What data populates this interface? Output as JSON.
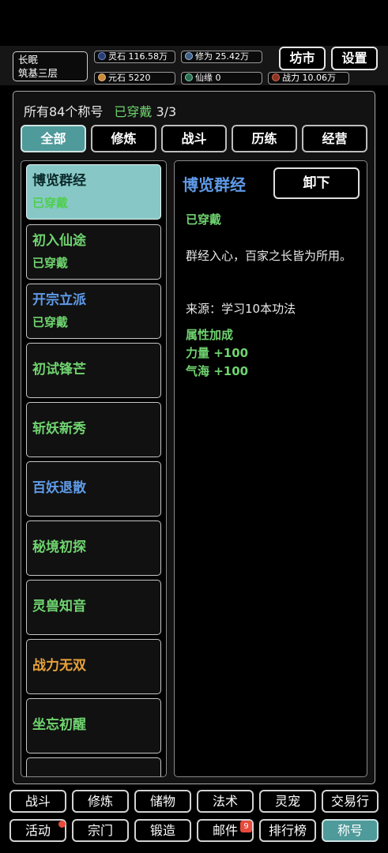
{
  "profile": {
    "name": "长眠",
    "realm": "筑基三层"
  },
  "stats": {
    "lingshi": {
      "label": "灵石",
      "value": "116.58万",
      "icon": "spirit-stone-icon"
    },
    "xiuwei": {
      "label": "修为",
      "value": "25.42万",
      "icon": "cultivation-icon"
    },
    "yuanshi": {
      "label": "元石",
      "value": "5220",
      "icon": "yuan-stone-icon"
    },
    "xianyuan": {
      "label": "仙缘",
      "value": "0",
      "icon": "immortal-fate-icon"
    },
    "zhanli": {
      "label": "战力",
      "value": "10.06万",
      "icon": "combat-power-icon"
    }
  },
  "top_buttons": {
    "market": "坊市",
    "settings": "设置"
  },
  "summary": {
    "total": "所有84个称号",
    "equipped_label": "已穿戴",
    "equipped_count": "3/3"
  },
  "tabs": [
    "全部",
    "修炼",
    "战斗",
    "历练",
    "经营"
  ],
  "active_tab": 0,
  "titles": [
    {
      "name": "博览群经",
      "status": "已穿戴",
      "color": "#0b2a2a",
      "selected": true
    },
    {
      "name": "初入仙途",
      "status": "已穿戴",
      "color": "#6fd36f"
    },
    {
      "name": "开宗立派",
      "status": "已穿戴",
      "color": "#5f9be8"
    },
    {
      "name": "初试锋芒",
      "status": "",
      "color": "#6fd36f"
    },
    {
      "name": "斩妖新秀",
      "status": "",
      "color": "#6fd36f"
    },
    {
      "name": "百妖退散",
      "status": "",
      "color": "#5f9be8"
    },
    {
      "name": "秘境初探",
      "status": "",
      "color": "#6fd36f"
    },
    {
      "name": "灵兽知音",
      "status": "",
      "color": "#6fd36f"
    },
    {
      "name": "战力无双",
      "status": "",
      "color": "#e8a23c"
    },
    {
      "name": "坐忘初醒",
      "status": "",
      "color": "#6fd36f"
    }
  ],
  "detail": {
    "title": "博览群经",
    "action": "卸下",
    "status": "已穿戴",
    "description": "群经入心，百家之长皆为所用。",
    "source": "来源：学习10本功法",
    "attr_header": "属性加成",
    "attrs": [
      "力量 +100",
      "气海 +100"
    ]
  },
  "nav": {
    "row1": [
      "战斗",
      "修炼",
      "储物",
      "法术",
      "灵宠",
      "交易行"
    ],
    "row2": [
      "活动",
      "宗门",
      "锻造",
      "邮件",
      "排行榜",
      "称号"
    ],
    "mail_badge": "9",
    "active": "称号"
  },
  "colors": {
    "accent_teal": "#4f9a9a",
    "green": "#6fd36f",
    "blue": "#5f9be8",
    "orange": "#e8a23c",
    "badge_red": "#e84a3c"
  }
}
